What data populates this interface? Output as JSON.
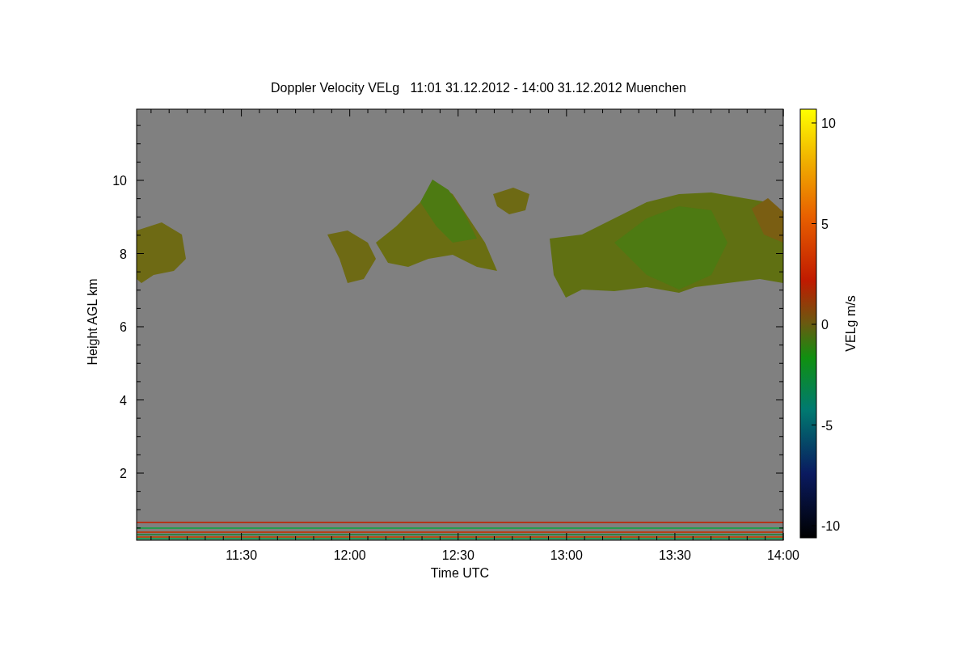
{
  "title": "Doppler Velocity VELg   11:01 31.12.2012 - 14:00 31.12.2012 Muenchen",
  "y_axis": {
    "label": "Height AGL km",
    "ticks": [
      "10",
      "8",
      "6",
      "4",
      "2"
    ]
  },
  "x_axis": {
    "label": "Time UTC",
    "ticks": [
      "11:30",
      "12:00",
      "12:30",
      "13:00",
      "13:30",
      "14:00"
    ]
  },
  "colorbar": {
    "label": "VELg m/s",
    "ticks": [
      "10",
      "5",
      "0",
      "-5",
      "-10"
    ]
  }
}
